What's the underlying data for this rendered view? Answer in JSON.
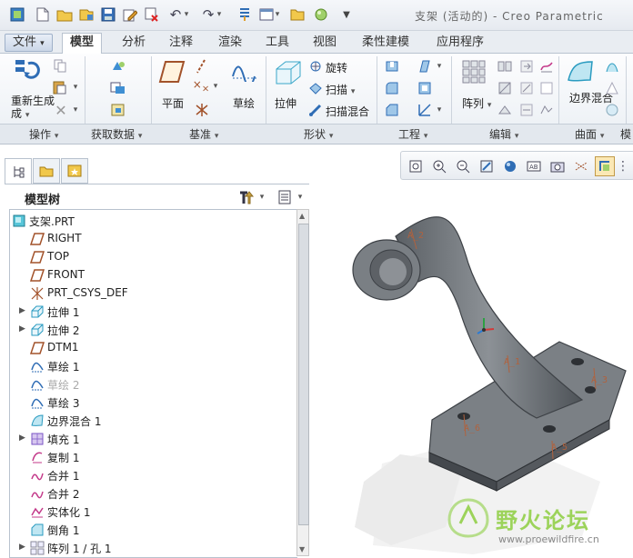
{
  "window": {
    "title": "支架 (活动的) - Creo Parametric",
    "quick_access_icons": [
      "new-icon",
      "open-icon",
      "save-icon",
      "save-as-icon",
      "print-icon",
      "close-icon",
      "undo-icon",
      "redo-icon",
      "regenerate-icon",
      "windows-icon",
      "folder-icon",
      "appearance-icon",
      "customize-icon"
    ]
  },
  "ribbon": {
    "tabs": [
      "文件",
      "模型",
      "分析",
      "注释",
      "渲染",
      "工具",
      "视图",
      "柔性建模",
      "应用程序"
    ],
    "active_tab": "模型",
    "groups": {
      "operations": {
        "label": "操作",
        "regenerate": "重新生成"
      },
      "get_data": {
        "label": "获取数据"
      },
      "datum": {
        "label": "基准",
        "plane": "平面",
        "sketch": "草绘"
      },
      "shapes": {
        "label": "形状",
        "extrude": "拉伸",
        "revolve": "旋转",
        "sweep": "扫描",
        "swept_blend": "扫描混合"
      },
      "engineering": {
        "label": "工程"
      },
      "editing": {
        "label": "编辑",
        "pattern": "阵列"
      },
      "surfaces": {
        "label": "曲面",
        "boundary_blend": "边界混合"
      },
      "more": {
        "label": "模"
      }
    }
  },
  "model_tree": {
    "title": "模型树",
    "items": [
      {
        "label": "支架.PRT",
        "icon": "part-icon",
        "expandable": false,
        "dim": false
      },
      {
        "label": "RIGHT",
        "icon": "datum-plane-icon",
        "expandable": false,
        "dim": false
      },
      {
        "label": "TOP",
        "icon": "datum-plane-icon",
        "expandable": false,
        "dim": false
      },
      {
        "label": "FRONT",
        "icon": "datum-plane-icon",
        "expandable": false,
        "dim": false
      },
      {
        "label": "PRT_CSYS_DEF",
        "icon": "csys-icon",
        "expandable": false,
        "dim": false
      },
      {
        "label": "拉伸 1",
        "icon": "extrude-icon",
        "expandable": true,
        "dim": false
      },
      {
        "label": "拉伸 2",
        "icon": "extrude-icon",
        "expandable": true,
        "dim": false
      },
      {
        "label": "DTM1",
        "icon": "datum-plane-icon",
        "expandable": false,
        "dim": false
      },
      {
        "label": "草绘 1",
        "icon": "sketch-icon",
        "expandable": false,
        "dim": false
      },
      {
        "label": "草绘 2",
        "icon": "sketch-icon",
        "expandable": false,
        "dim": true
      },
      {
        "label": "草绘 3",
        "icon": "sketch-icon",
        "expandable": false,
        "dim": false
      },
      {
        "label": "边界混合 1",
        "icon": "boundary-blend-icon",
        "expandable": false,
        "dim": false
      },
      {
        "label": "填充 1",
        "icon": "fill-icon",
        "expandable": true,
        "dim": false
      },
      {
        "label": "复制 1",
        "icon": "copy-icon",
        "expandable": false,
        "dim": false
      },
      {
        "label": "合并 1",
        "icon": "merge-icon",
        "expandable": false,
        "dim": false
      },
      {
        "label": "合并 2",
        "icon": "merge-icon",
        "expandable": false,
        "dim": false
      },
      {
        "label": "实体化 1",
        "icon": "solidify-icon",
        "expandable": false,
        "dim": false
      },
      {
        "label": "倒角 1",
        "icon": "chamfer-icon",
        "expandable": false,
        "dim": false
      },
      {
        "label": "阵列 1 / 孔 1",
        "icon": "pattern-icon",
        "expandable": true,
        "dim": false
      }
    ]
  },
  "viewport": {
    "axis_labels": [
      "A_2",
      "A_1",
      "A_3",
      "A_6",
      "A_5"
    ]
  },
  "watermark": {
    "text": "野火论坛",
    "url": "www.proewildfire.cn"
  },
  "colors": {
    "model_body": "#6e7378",
    "axis_label": "#b0623e",
    "accent": "#2f6db5"
  }
}
